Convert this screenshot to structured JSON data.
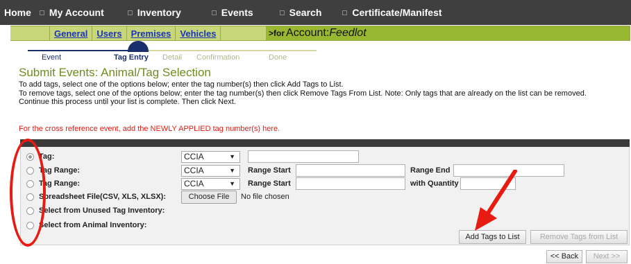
{
  "topnav": {
    "items": [
      {
        "label": "Home"
      },
      {
        "label": "My Account"
      },
      {
        "label": "Inventory"
      },
      {
        "label": "Events"
      },
      {
        "label": "Search"
      },
      {
        "label": "Certificate/Manifest"
      }
    ]
  },
  "subnav": {
    "tabs": [
      {
        "label": "General"
      },
      {
        "label": "Users"
      },
      {
        "label": "Premises"
      },
      {
        "label": "Vehicles"
      }
    ],
    "for_prefix": ">for",
    "account_label": "Account:",
    "account_name": "Feedlot"
  },
  "steps": [
    {
      "label": "Event"
    },
    {
      "label": "Tag Entry"
    },
    {
      "label": "Detail"
    },
    {
      "label": "Confirmation"
    },
    {
      "label": "Done"
    }
  ],
  "page": {
    "title": "Submit Events: Animal/Tag Selection",
    "instructions": [
      "To add tags, select one of the options below; enter the tag number(s) then click Add Tags to List.",
      "To remove tags, select one of the options below; enter the tag number(s) then click Remove Tags From List. Note: Only tags that are already on the list can be removed.",
      "Continue this process until your list is complete. Then click Next."
    ],
    "red_note": "For the cross reference event, add the NEWLY APPLIED tag number(s) here."
  },
  "form": {
    "options": [
      {
        "label": "Tag:",
        "selected": true
      },
      {
        "label": "Tag Range:",
        "selected": false
      },
      {
        "label": "Tag Range:",
        "selected": false
      },
      {
        "label": "Spreadsheet File(CSV, XLS, XLSX):",
        "selected": false
      },
      {
        "label": "Select from Unused Tag Inventory:",
        "selected": false
      },
      {
        "label": "Select from Animal Inventory:",
        "selected": false
      }
    ],
    "tag_type_selected": "CCIA",
    "range_start_label": "Range Start",
    "range_end_label": "Range End",
    "with_quantity_label": "with Quantity",
    "choose_file_label": "Choose File",
    "no_file_text": "No file chosen",
    "add_button": "Add Tags to List",
    "remove_button": "Remove Tags from List"
  },
  "footer": {
    "back_button": "<< Back",
    "next_button": "Next >>"
  },
  "colors": {
    "topnav_bg": "#3f3f3f",
    "subnav_tabs_bg": "#c8d67a",
    "forbar_bg": "#98b831",
    "title_green": "#6e8c1e",
    "annotation_red": "#e81b12"
  }
}
